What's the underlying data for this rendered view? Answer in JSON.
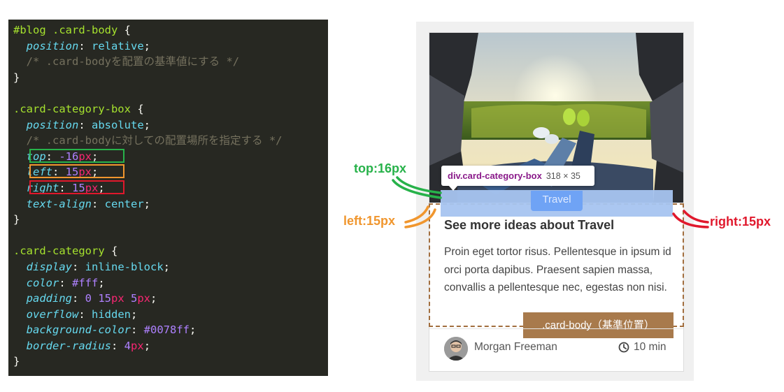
{
  "code": {
    "lines": [
      [
        {
          "t": "#blog .card-body",
          "c": "sel"
        },
        {
          "t": " {",
          "c": "pun"
        }
      ],
      [
        {
          "t": "  "
        },
        {
          "t": "position",
          "c": "prop"
        },
        {
          "t": ": ",
          "c": "pun"
        },
        {
          "t": "relative",
          "c": "val"
        },
        {
          "t": ";",
          "c": "pun"
        }
      ],
      [
        {
          "t": "  /* .card-bodyを配置の基準値にする */",
          "c": "cmt"
        }
      ],
      [
        {
          "t": "}",
          "c": "pun"
        }
      ],
      [
        {
          "t": ""
        }
      ],
      [
        {
          "t": ".card-category-box",
          "c": "sel"
        },
        {
          "t": " {",
          "c": "pun"
        }
      ],
      [
        {
          "t": "  "
        },
        {
          "t": "position",
          "c": "prop"
        },
        {
          "t": ": ",
          "c": "pun"
        },
        {
          "t": "absolute",
          "c": "val"
        },
        {
          "t": ";",
          "c": "pun"
        }
      ],
      [
        {
          "t": "  /* .card-bodyに対しての配置場所を指定する */",
          "c": "cmt"
        }
      ],
      [
        {
          "t": "  "
        },
        {
          "t": "top",
          "c": "prop"
        },
        {
          "t": ": ",
          "c": "pun"
        },
        {
          "t": "-16",
          "c": "num"
        },
        {
          "t": "px",
          "c": "unit"
        },
        {
          "t": ";",
          "c": "pun"
        }
      ],
      [
        {
          "t": "  "
        },
        {
          "t": "left",
          "c": "prop"
        },
        {
          "t": ": ",
          "c": "pun"
        },
        {
          "t": "15",
          "c": "num"
        },
        {
          "t": "px",
          "c": "unit"
        },
        {
          "t": ";",
          "c": "pun"
        }
      ],
      [
        {
          "t": "  "
        },
        {
          "t": "right",
          "c": "prop"
        },
        {
          "t": ": ",
          "c": "pun"
        },
        {
          "t": "15",
          "c": "num"
        },
        {
          "t": "px",
          "c": "unit"
        },
        {
          "t": ";",
          "c": "pun"
        }
      ],
      [
        {
          "t": "  "
        },
        {
          "t": "text-align",
          "c": "prop"
        },
        {
          "t": ": ",
          "c": "pun"
        },
        {
          "t": "center",
          "c": "val"
        },
        {
          "t": ";",
          "c": "pun"
        }
      ],
      [
        {
          "t": "}",
          "c": "pun"
        }
      ],
      [
        {
          "t": ""
        }
      ],
      [
        {
          "t": ".card-category",
          "c": "sel"
        },
        {
          "t": " {",
          "c": "pun"
        }
      ],
      [
        {
          "t": "  "
        },
        {
          "t": "display",
          "c": "prop"
        },
        {
          "t": ": ",
          "c": "pun"
        },
        {
          "t": "inline-block",
          "c": "val"
        },
        {
          "t": ";",
          "c": "pun"
        }
      ],
      [
        {
          "t": "  "
        },
        {
          "t": "color",
          "c": "prop"
        },
        {
          "t": ": ",
          "c": "pun"
        },
        {
          "t": "#fff",
          "c": "num"
        },
        {
          "t": ";",
          "c": "pun"
        }
      ],
      [
        {
          "t": "  "
        },
        {
          "t": "padding",
          "c": "prop"
        },
        {
          "t": ": ",
          "c": "pun"
        },
        {
          "t": "0 15",
          "c": "num"
        },
        {
          "t": "px",
          "c": "unit"
        },
        {
          "t": " 5",
          "c": "num"
        },
        {
          "t": "px",
          "c": "unit"
        },
        {
          "t": ";",
          "c": "pun"
        }
      ],
      [
        {
          "t": "  "
        },
        {
          "t": "overflow",
          "c": "prop"
        },
        {
          "t": ": ",
          "c": "pun"
        },
        {
          "t": "hidden",
          "c": "val"
        },
        {
          "t": ";",
          "c": "pun"
        }
      ],
      [
        {
          "t": "  "
        },
        {
          "t": "background-color",
          "c": "prop"
        },
        {
          "t": ": ",
          "c": "pun"
        },
        {
          "t": "#0078ff",
          "c": "num"
        },
        {
          "t": ";",
          "c": "pun"
        }
      ],
      [
        {
          "t": "  "
        },
        {
          "t": "border-radius",
          "c": "prop"
        },
        {
          "t": ": ",
          "c": "pun"
        },
        {
          "t": "4",
          "c": "num"
        },
        {
          "t": "px",
          "c": "unit"
        },
        {
          "t": ";",
          "c": "pun"
        }
      ],
      [
        {
          "t": "}",
          "c": "pun"
        }
      ]
    ],
    "highlights": [
      {
        "line": 8,
        "color": "green"
      },
      {
        "line": 9,
        "color": "orange"
      },
      {
        "line": 10,
        "color": "red"
      }
    ]
  },
  "preview": {
    "category_label": "Travel",
    "tooltip_tag": "div.card-category-box",
    "tooltip_dims": "318 × 35",
    "card_title": "See more ideas about Travel",
    "card_text": "Proin eget tortor risus. Pellentesque in ipsum id orci porta dapibus. Praesent sapien massa, convallis a pellentesque nec, egestas non nisi.",
    "body_label": ".card-body（基準位置）",
    "author": "Morgan Freeman",
    "time": "10 min",
    "icons": {
      "avatar": "avatar",
      "clock": "clock-icon"
    }
  },
  "annotations": {
    "top": "top:16px",
    "left": "left:15px",
    "right": "right:15px"
  },
  "colors": {
    "code_bg": "#272822",
    "green": "#27b24a",
    "orange": "#f0962e",
    "red": "#e0182c",
    "body_label_bg": "#a87a4c",
    "category_pill": "#6fa3f5"
  }
}
